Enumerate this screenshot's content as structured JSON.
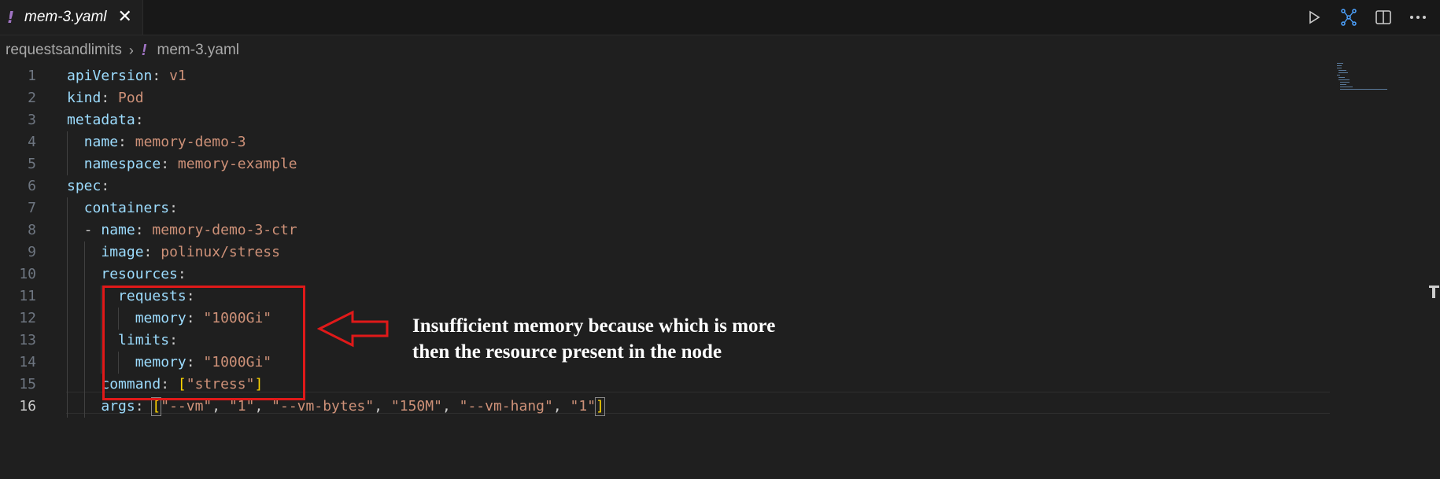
{
  "tab": {
    "icon": "yaml-exclamation-icon",
    "bang": "!",
    "filename": "mem-3.yaml",
    "close_icon": "close-icon"
  },
  "toolbar": {
    "run": "run-icon",
    "source_control": "source-control-graph-icon",
    "split": "split-editor-icon",
    "more": "more-actions-icon"
  },
  "breadcrumb": {
    "folder": "requestsandlimits",
    "bang": "!",
    "file": "mem-3.yaml"
  },
  "lines": [
    {
      "n": "1",
      "parts": [
        [
          "key",
          "apiVersion"
        ],
        [
          "pun",
          ": "
        ],
        [
          "str",
          "v1"
        ]
      ]
    },
    {
      "n": "2",
      "parts": [
        [
          "key",
          "kind"
        ],
        [
          "pun",
          ": "
        ],
        [
          "str",
          "Pod"
        ]
      ]
    },
    {
      "n": "3",
      "parts": [
        [
          "key",
          "metadata"
        ],
        [
          "pun",
          ":"
        ]
      ]
    },
    {
      "n": "4",
      "parts": [
        [
          "pun",
          "  "
        ],
        [
          "key",
          "name"
        ],
        [
          "pun",
          ": "
        ],
        [
          "str",
          "memory-demo-3"
        ]
      ]
    },
    {
      "n": "5",
      "parts": [
        [
          "pun",
          "  "
        ],
        [
          "key",
          "namespace"
        ],
        [
          "pun",
          ": "
        ],
        [
          "str",
          "memory-example"
        ]
      ]
    },
    {
      "n": "6",
      "parts": [
        [
          "key",
          "spec"
        ],
        [
          "pun",
          ":"
        ]
      ]
    },
    {
      "n": "7",
      "parts": [
        [
          "pun",
          "  "
        ],
        [
          "key",
          "containers"
        ],
        [
          "pun",
          ":"
        ]
      ]
    },
    {
      "n": "8",
      "parts": [
        [
          "pun",
          "  - "
        ],
        [
          "key",
          "name"
        ],
        [
          "pun",
          ": "
        ],
        [
          "str",
          "memory-demo-3-ctr"
        ]
      ]
    },
    {
      "n": "9",
      "parts": [
        [
          "pun",
          "    "
        ],
        [
          "key",
          "image"
        ],
        [
          "pun",
          ": "
        ],
        [
          "str",
          "polinux/stress"
        ]
      ]
    },
    {
      "n": "10",
      "parts": [
        [
          "pun",
          "    "
        ],
        [
          "key",
          "resources"
        ],
        [
          "pun",
          ":"
        ]
      ]
    },
    {
      "n": "11",
      "parts": [
        [
          "pun",
          "      "
        ],
        [
          "key",
          "requests"
        ],
        [
          "pun",
          ":"
        ]
      ]
    },
    {
      "n": "12",
      "parts": [
        [
          "pun",
          "        "
        ],
        [
          "key",
          "memory"
        ],
        [
          "pun",
          ": "
        ],
        [
          "str",
          "\"1000Gi\""
        ]
      ]
    },
    {
      "n": "13",
      "parts": [
        [
          "pun",
          "      "
        ],
        [
          "key",
          "limits"
        ],
        [
          "pun",
          ":"
        ]
      ]
    },
    {
      "n": "14",
      "parts": [
        [
          "pun",
          "        "
        ],
        [
          "key",
          "memory"
        ],
        [
          "pun",
          ": "
        ],
        [
          "str",
          "\"1000Gi\""
        ]
      ]
    },
    {
      "n": "15",
      "parts": [
        [
          "pun",
          "    "
        ],
        [
          "key",
          "command"
        ],
        [
          "pun",
          ": "
        ],
        [
          "brk",
          "["
        ],
        [
          "str",
          "\"stress\""
        ],
        [
          "brk",
          "]"
        ]
      ]
    },
    {
      "n": "16",
      "parts": [
        [
          "pun",
          "    "
        ],
        [
          "key",
          "args"
        ],
        [
          "pun",
          ": "
        ],
        [
          "brk",
          "["
        ],
        [
          "str",
          "\"--vm\""
        ],
        [
          "pun",
          ", "
        ],
        [
          "str",
          "\"1\""
        ],
        [
          "pun",
          ", "
        ],
        [
          "str",
          "\"--vm-bytes\""
        ],
        [
          "pun",
          ", "
        ],
        [
          "str",
          "\"150M\""
        ],
        [
          "pun",
          ", "
        ],
        [
          "str",
          "\"--vm-hang\""
        ],
        [
          "pun",
          ", "
        ],
        [
          "str",
          "\"1\""
        ],
        [
          "brk",
          "]"
        ]
      ]
    }
  ],
  "active_line": "16",
  "annotation": {
    "line1": "Insufficient  memory because which is more",
    "line2": "then the resource present in the node"
  },
  "colors": {
    "highlight": "#e01919",
    "key": "#9cdcfe",
    "string": "#ce9178",
    "bracket": "#ffd700"
  }
}
